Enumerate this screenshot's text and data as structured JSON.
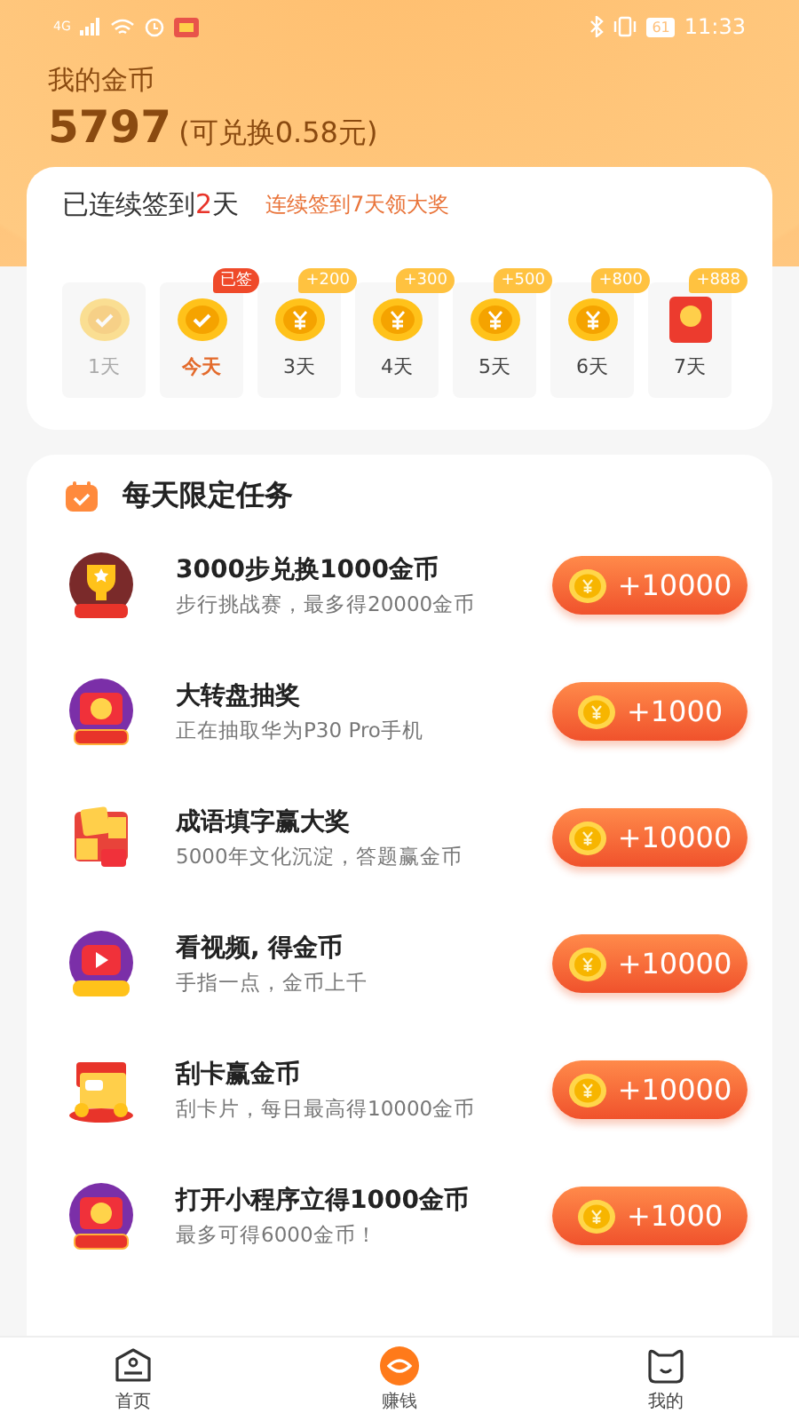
{
  "status_bar": {
    "network": "4G",
    "battery": "61",
    "time": "11:33"
  },
  "wallet": {
    "label": "我的金币",
    "coins": "5797",
    "exchange": "(可兑换0.58元)"
  },
  "checkin": {
    "streak_prefix": "已连续签到",
    "streak_days": "2",
    "streak_suffix": "天",
    "promo": "连续签到7天领大奖",
    "days": [
      {
        "label": "1天",
        "kind": "coin",
        "signed": true,
        "selected": false
      },
      {
        "label": "今天",
        "kind": "coin",
        "signed": true,
        "selected": true,
        "badge": "已签"
      },
      {
        "label": "3天",
        "kind": "coin",
        "signed": false,
        "selected": false,
        "badge": "+200"
      },
      {
        "label": "4天",
        "kind": "coin",
        "signed": false,
        "selected": false,
        "badge": "+300"
      },
      {
        "label": "5天",
        "kind": "coin",
        "signed": false,
        "selected": false,
        "badge": "+500"
      },
      {
        "label": "6天",
        "kind": "coin",
        "signed": false,
        "selected": false,
        "badge": "+800"
      },
      {
        "label": "7天",
        "kind": "envelope",
        "signed": false,
        "selected": false,
        "badge": "+888"
      }
    ]
  },
  "tasks": {
    "title": "每天限定任务",
    "items": [
      {
        "kind": "trophy",
        "title": "3000步兑换1000金币",
        "subtitle": "步行挑战赛，最多得20000金币",
        "reward": "+10000"
      },
      {
        "kind": "lucky",
        "title": "大转盘抽奖",
        "subtitle": "正在抽取华为P30 Pro手机",
        "reward": "+1000"
      },
      {
        "kind": "idiom",
        "title": "成语填字赢大奖",
        "subtitle": "5000年文化沉淀，答题赢金币",
        "reward": "+10000"
      },
      {
        "kind": "video",
        "title": "看视频, 得金币",
        "subtitle": "手指一点，金币上千",
        "reward": "+10000"
      },
      {
        "kind": "card",
        "title": "刮卡赢金币",
        "subtitle": "刮卡片，每日最高得10000金币",
        "reward": "+10000"
      },
      {
        "kind": "lucky",
        "title": "打开小程序立得1000金币",
        "subtitle": "最多可得6000金币！",
        "reward": "+1000"
      }
    ]
  },
  "tab_bar": [
    {
      "label": "首页",
      "kind": "home",
      "selected": false
    },
    {
      "label": "赚钱",
      "kind": "earn",
      "selected": true
    },
    {
      "label": "我的",
      "kind": "me",
      "selected": false
    }
  ]
}
